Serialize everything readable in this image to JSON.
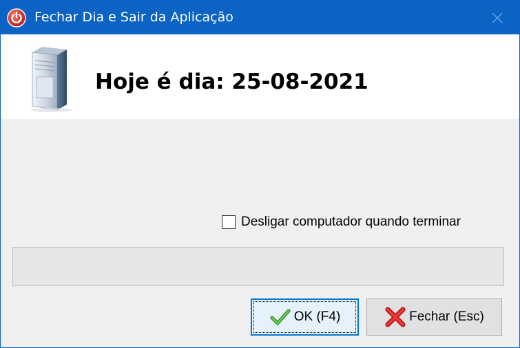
{
  "window": {
    "title": "Fechar Dia e Sair da Aplicação",
    "title_icon": "power-icon",
    "close_icon": "close-icon"
  },
  "header": {
    "icon": "server-icon",
    "date_text": "Hoje é dia: 25-08-2021"
  },
  "options": {
    "shutdown_label": "Desligar computador quando terminar",
    "shutdown_checked": false
  },
  "progress": {
    "value": 0
  },
  "buttons": {
    "ok_label": "OK (F4)",
    "ok_icon": "checkmark-icon",
    "close_label": "Fechar (Esc)",
    "close_icon": "red-x-icon"
  },
  "colors": {
    "titlebar": "#0b63c4",
    "ok_border": "#0078d7",
    "check_green": "#3fae2a",
    "x_red": "#d62020"
  }
}
